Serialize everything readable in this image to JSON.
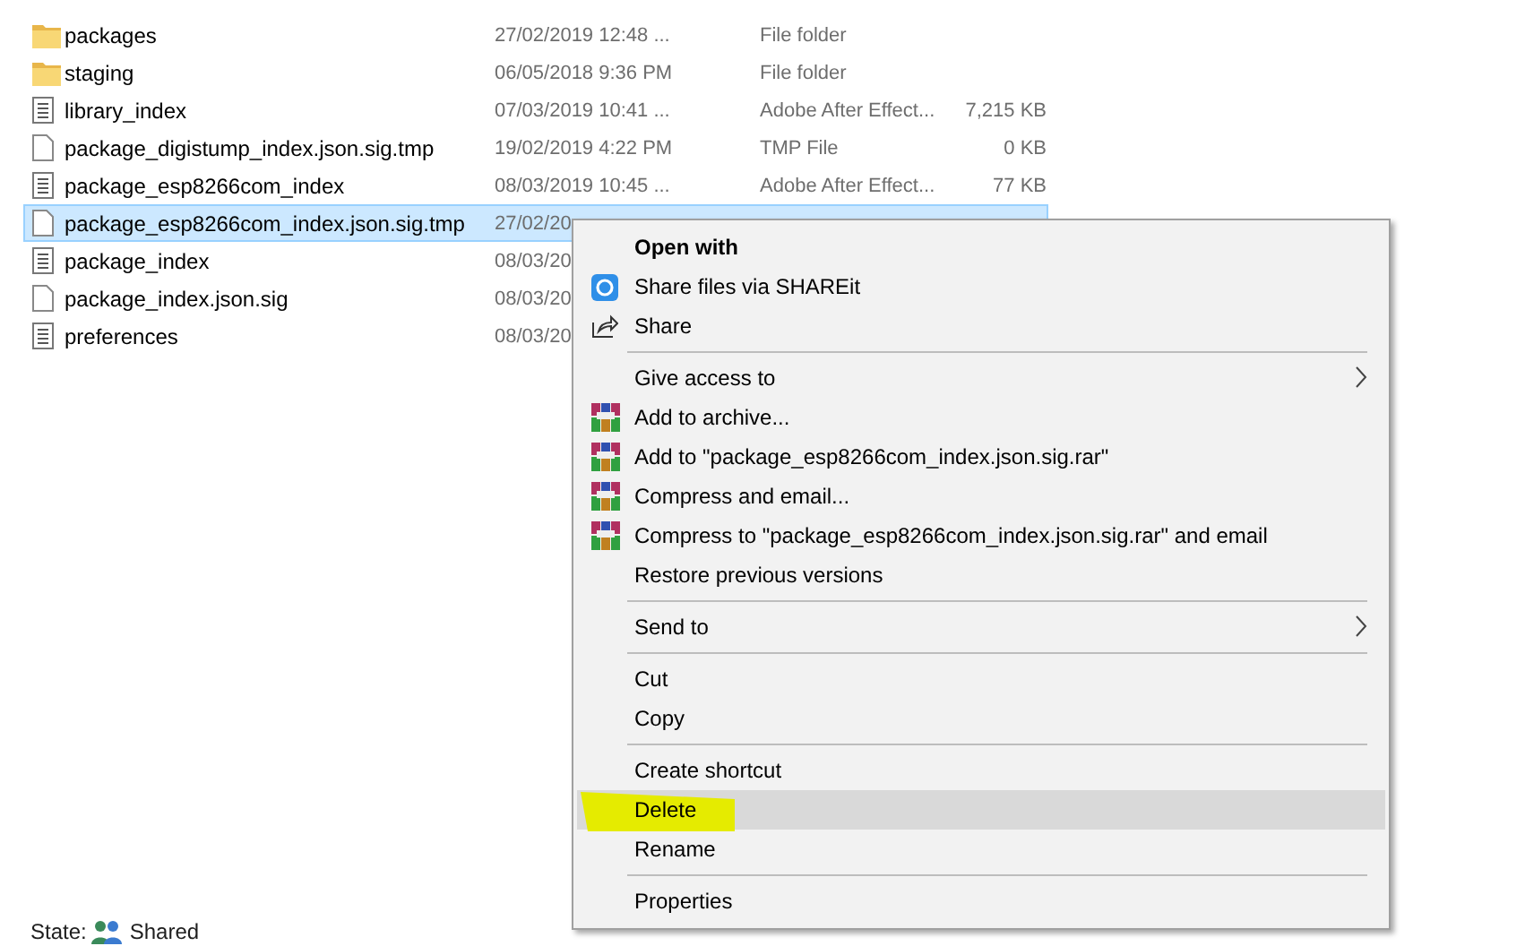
{
  "files": [
    {
      "name": "packages",
      "kind": "folder",
      "date": "27/02/2019 12:48 ...",
      "type": "File folder",
      "selected": false
    },
    {
      "name": "staging",
      "kind": "folder",
      "date": "06/05/2018 9:36 PM",
      "type": "File folder",
      "selected": false
    },
    {
      "name": "library_index",
      "kind": "document",
      "date": "07/03/2019 10:41 ...",
      "type": "Adobe After Effect...",
      "size": "7,215 KB",
      "selected": false
    },
    {
      "name": "package_digistump_index.json.sig.tmp",
      "kind": "blank",
      "date": "19/02/2019 4:22 PM",
      "type": "TMP File",
      "size": "0 KB",
      "selected": false
    },
    {
      "name": "package_esp8266com_index",
      "kind": "document",
      "date": "08/03/2019 10:45 ...",
      "type": "Adobe After Effect...",
      "size": "77 KB",
      "selected": false
    },
    {
      "name": "package_esp8266com_index.json.sig.tmp",
      "kind": "blank",
      "date": "27/02/20",
      "selected": true
    },
    {
      "name": "package_index",
      "kind": "document",
      "date": "08/03/20",
      "selected": false
    },
    {
      "name": "package_index.json.sig",
      "kind": "blank",
      "date": "08/03/20",
      "selected": false
    },
    {
      "name": "preferences",
      "kind": "document",
      "date": "08/03/20",
      "selected": false
    }
  ],
  "context_menu": [
    {
      "kind": "plain",
      "label": "Open with",
      "bold": true,
      "submenu": false,
      "selected": false,
      "highlighted": false
    },
    {
      "kind": "shareit",
      "label": "Share files via SHAREit",
      "bold": false,
      "submenu": false,
      "selected": false,
      "highlighted": false
    },
    {
      "kind": "share",
      "label": "Share",
      "bold": false,
      "submenu": false,
      "selected": false,
      "highlighted": false
    },
    {
      "kind": "separator"
    },
    {
      "kind": "plain",
      "label": "Give access to",
      "bold": false,
      "submenu": true,
      "selected": false,
      "highlighted": false
    },
    {
      "kind": "archive",
      "label": "Add to archive...",
      "bold": false,
      "submenu": false,
      "selected": false,
      "highlighted": false
    },
    {
      "kind": "archive",
      "label": "Add to \"package_esp8266com_index.json.sig.rar\"",
      "bold": false,
      "submenu": false,
      "selected": false,
      "highlighted": false
    },
    {
      "kind": "archive",
      "label": "Compress and email...",
      "bold": false,
      "submenu": false,
      "selected": false,
      "highlighted": false
    },
    {
      "kind": "archive",
      "label": "Compress to \"package_esp8266com_index.json.sig.rar\" and email",
      "bold": false,
      "submenu": false,
      "selected": false,
      "highlighted": false
    },
    {
      "kind": "plain",
      "label": "Restore previous versions",
      "bold": false,
      "submenu": false,
      "selected": false,
      "highlighted": false
    },
    {
      "kind": "separator"
    },
    {
      "kind": "plain",
      "label": "Send to",
      "bold": false,
      "submenu": true,
      "selected": false,
      "highlighted": false
    },
    {
      "kind": "separator"
    },
    {
      "kind": "plain",
      "label": "Cut",
      "bold": false,
      "submenu": false,
      "selected": false,
      "highlighted": false
    },
    {
      "kind": "plain",
      "label": "Copy",
      "bold": false,
      "submenu": false,
      "selected": false,
      "highlighted": false
    },
    {
      "kind": "separator"
    },
    {
      "kind": "plain",
      "label": "Create shortcut",
      "bold": false,
      "submenu": false,
      "selected": false,
      "highlighted": false
    },
    {
      "kind": "plain",
      "label": "Delete",
      "bold": false,
      "submenu": false,
      "selected": true,
      "highlighted": true
    },
    {
      "kind": "plain",
      "label": "Rename",
      "bold": false,
      "submenu": false,
      "selected": false,
      "highlighted": false
    },
    {
      "kind": "separator"
    },
    {
      "kind": "plain",
      "label": "Properties",
      "bold": false,
      "submenu": false,
      "selected": false,
      "highlighted": false
    }
  ],
  "status_bar": {
    "label": "State:",
    "value": "Shared"
  }
}
